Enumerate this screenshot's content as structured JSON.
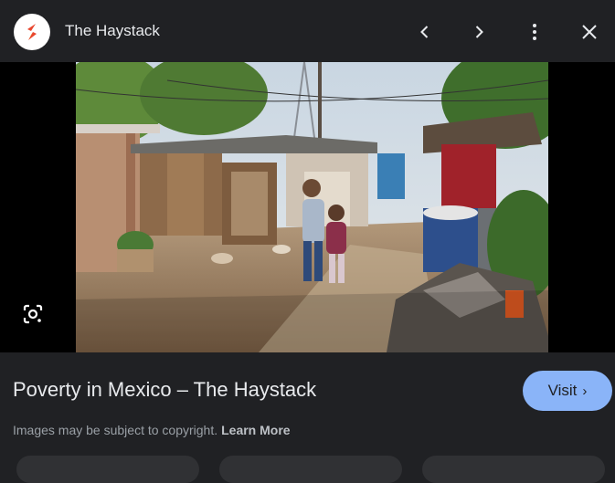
{
  "header": {
    "site_name": "The Haystack"
  },
  "result": {
    "title": "Poverty in Mexico – The Haystack",
    "visit_label": "Visit",
    "copyright_text": "Images may be subject to copyright.",
    "learn_more_label": "Learn More"
  },
  "colors": {
    "background": "#202124",
    "accent": "#8ab4f8",
    "text_primary": "#e8eaed",
    "text_secondary": "#9aa0a6",
    "logo_red": "#e8472f",
    "logo_orange": "#f29a1e"
  },
  "icons": {
    "back": "chevron-left-icon",
    "forward": "chevron-right-icon",
    "menu": "more-vert-icon",
    "close": "close-icon",
    "lens": "google-lens-icon"
  }
}
